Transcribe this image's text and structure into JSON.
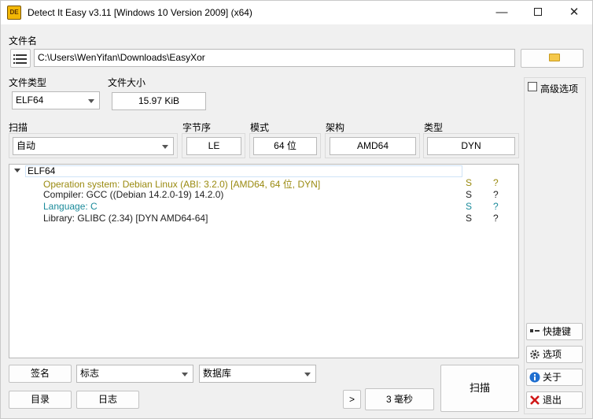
{
  "window": {
    "title": "Detect It Easy v3.11 [Windows 10 Version 2009] (x64)",
    "icon": "DE"
  },
  "file": {
    "label": "文件名",
    "path": "C:\\Users\\WenYifan\\Downloads\\EasyXor"
  },
  "filetype": {
    "label": "文件类型",
    "value": "ELF64"
  },
  "filesize": {
    "label": "文件大小",
    "value": "15.97 KiB"
  },
  "scan": {
    "label": "扫描",
    "value": "自动"
  },
  "endian": {
    "label": "字节序",
    "value": "LE"
  },
  "mode": {
    "label": "模式",
    "value": "64 位"
  },
  "arch": {
    "label": "架构",
    "value": "AMD64"
  },
  "type": {
    "label": "类型",
    "value": "DYN"
  },
  "advanced": {
    "label": "高级选项",
    "checked": false
  },
  "results": {
    "root": "ELF64",
    "rows": [
      {
        "text": "Operation system: Debian Linux (ABI: 3.2.0) [AMD64, 64 位, DYN]",
        "flag": "S",
        "q": "?",
        "color": "#9a8a10"
      },
      {
        "text": "Compiler: GCC ((Debian 14.2.0-19) 14.2.0)",
        "flag": "S",
        "q": "?",
        "color": "#222222"
      },
      {
        "text": "Language: C",
        "flag": "S",
        "q": "?",
        "color": "#1a8a9a"
      },
      {
        "text": "Library: GLIBC (2.34) [DYN AMD64-64]",
        "flag": "S",
        "q": "?",
        "color": "#222222"
      }
    ]
  },
  "bottom": {
    "signature": "签名",
    "flags": "标志",
    "database": "数据库",
    "directory": "目录",
    "log": "日志",
    "next": ">",
    "time": "3 毫秒",
    "scan_button": "扫描"
  },
  "side": {
    "shortcuts": "快捷键",
    "options": "选项",
    "about": "关于",
    "exit": "退出"
  },
  "colors": {
    "accent": "#0066cc",
    "exit_red": "#d01818"
  }
}
